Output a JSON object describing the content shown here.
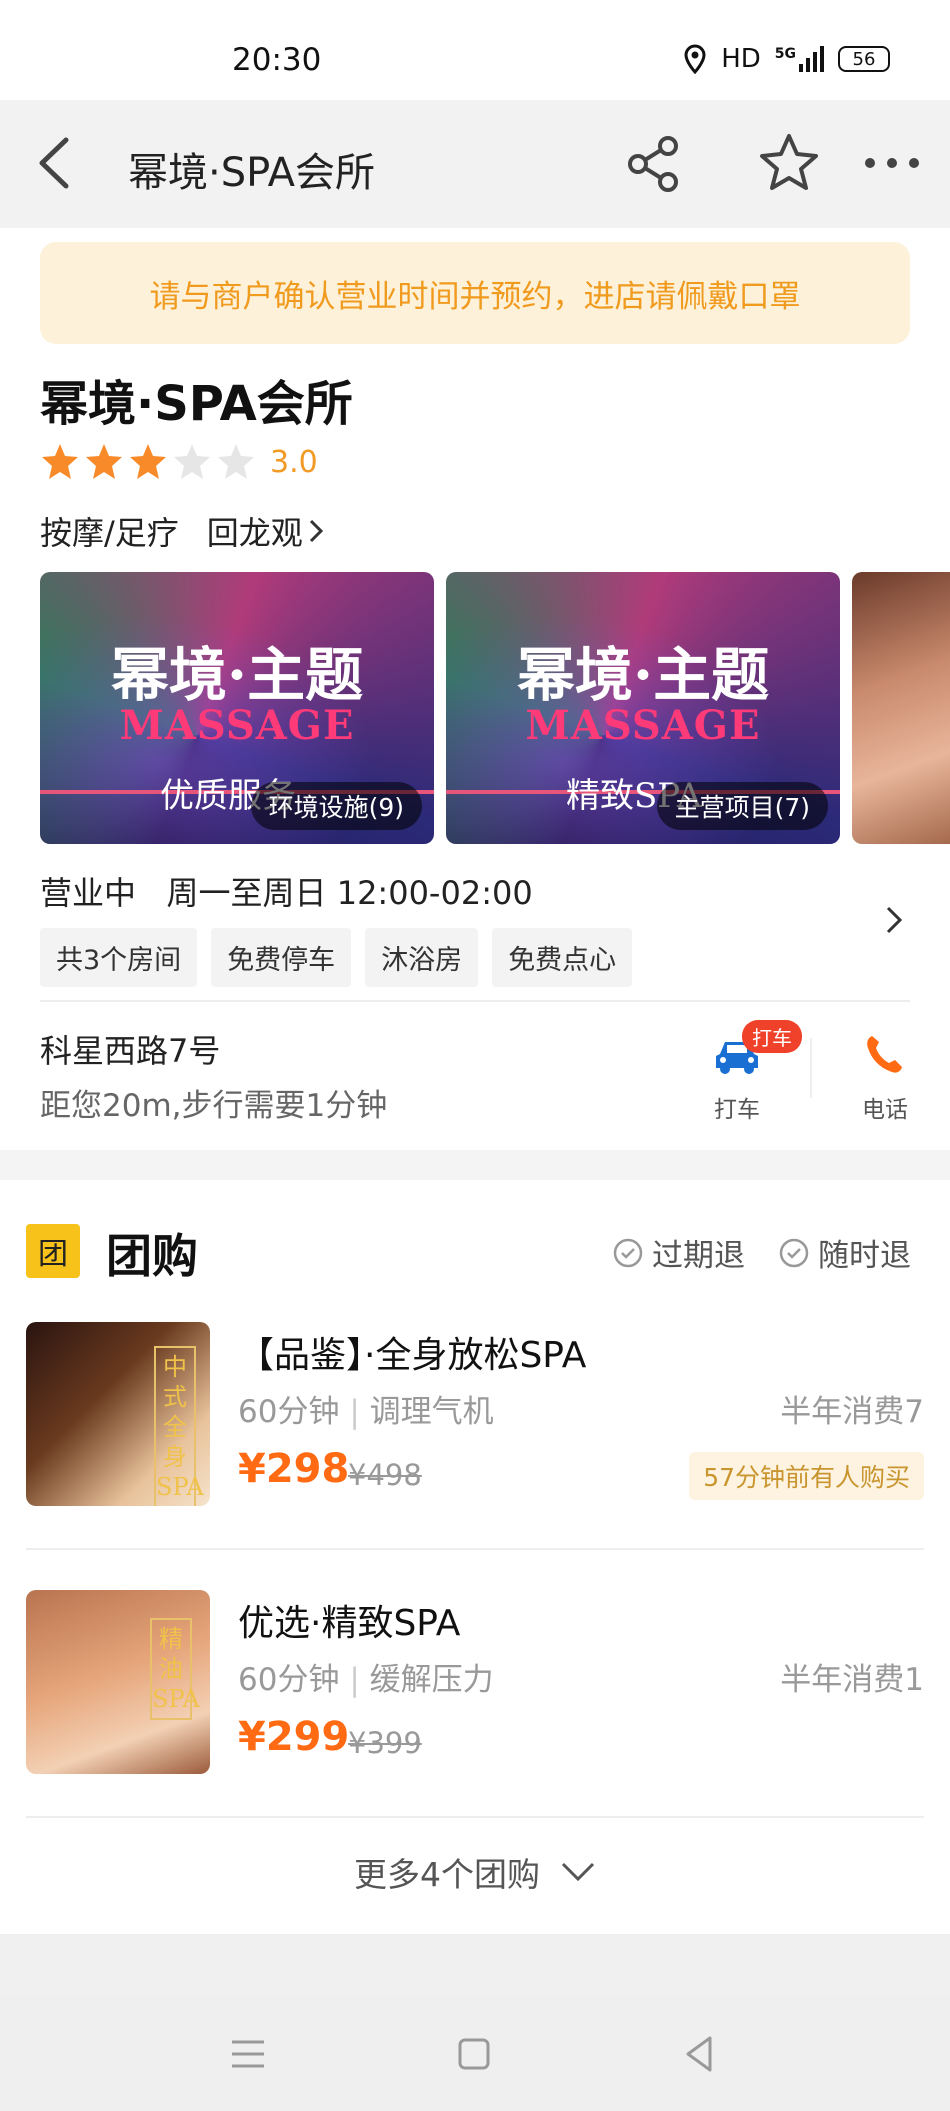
{
  "status": {
    "time": "20:30",
    "hd": "HD",
    "network": "5G",
    "battery": "56"
  },
  "nav": {
    "title": "幂境·SPA会所"
  },
  "notice": "请与商户确认营业时间并预约，进店请佩戴口罩",
  "shop": {
    "name": "幂境·SPA会所",
    "rating": "3.0",
    "rating_value": 3,
    "category": "按摩/足疗",
    "area": "回龙观"
  },
  "photos": [
    {
      "title": "幂境·主题",
      "sub_title": "MASSAGE",
      "caption": "优质服务",
      "label": "环境设施(9)"
    },
    {
      "title": "幂境·主题",
      "sub_title": "MASSAGE",
      "caption": "精致SPA",
      "label": "主营项目(7)"
    }
  ],
  "hours": {
    "status": "营业中",
    "time": "周一至周日 12:00-02:00"
  },
  "tags": [
    "共3个房间",
    "免费停车",
    "沐浴房",
    "免费点心"
  ],
  "location": {
    "address": "科星西路7号",
    "distance": "距您20m,步行需要1分钟",
    "taxi_badge": "打车",
    "taxi_label": "打车",
    "phone_label": "电话"
  },
  "group": {
    "badge": "团",
    "title": "团购",
    "refund_expired": "过期退",
    "refund_anytime": "随时退",
    "deals": [
      {
        "name": "【品鉴】·全身放松SPA",
        "duration": "60分钟",
        "effect": "调理气机",
        "sales": "半年消费7",
        "price": "¥298",
        "old_price": "¥498",
        "recent": "57分钟前有人购买",
        "thumb_text": "中式全身SPA"
      },
      {
        "name": "优选·精致SPA",
        "duration": "60分钟",
        "effect": "缓解压力",
        "sales": "半年消费1",
        "price": "¥299",
        "old_price": "¥399",
        "thumb_text": "精油SPA"
      }
    ],
    "more": "更多4个团购"
  },
  "colors": {
    "accent": "#ff6a13",
    "star": "#f98a2a",
    "notice_text": "#f09a1e",
    "taxi_icon": "#1a6fd3",
    "phone_icon": "#ff6a13"
  }
}
